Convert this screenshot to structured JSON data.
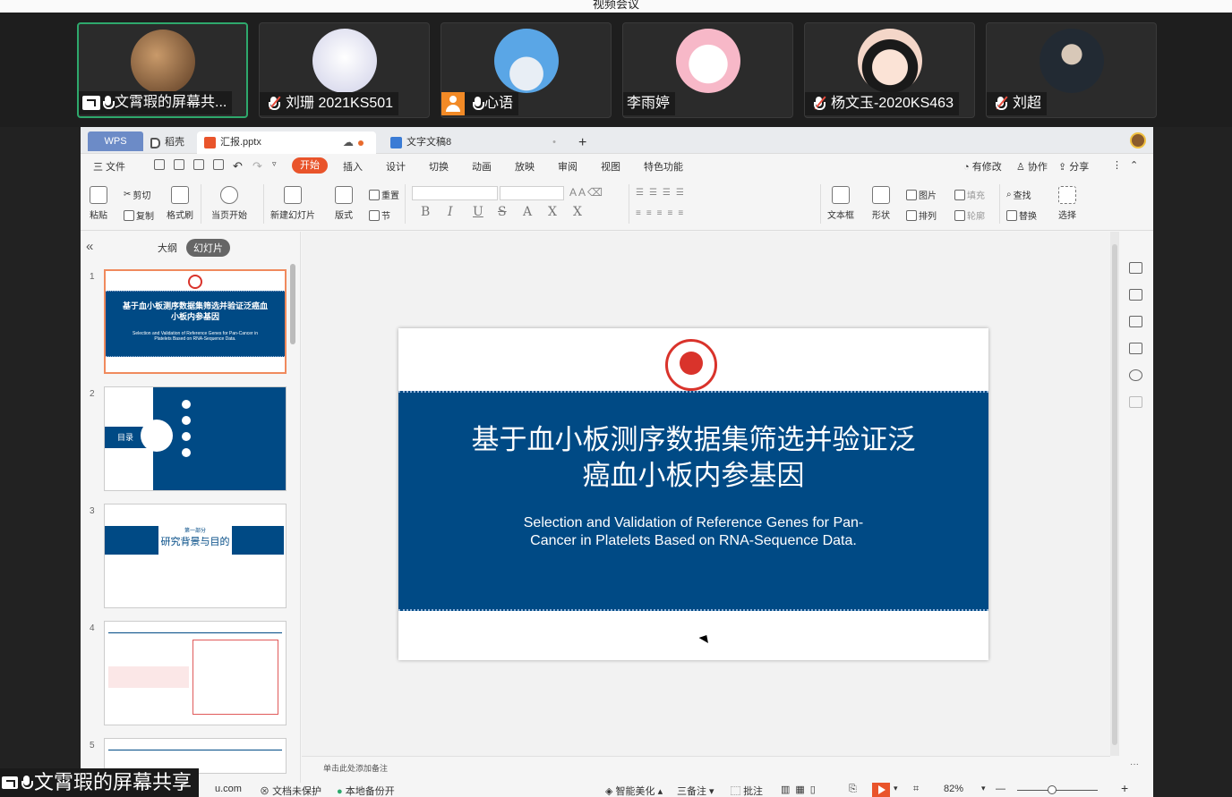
{
  "meeting": {
    "title": "视频会议",
    "participants": [
      {
        "name": "文霄瑕的屏幕共...",
        "sharing": true,
        "muted": false,
        "avatar_color": "#7a5a3a"
      },
      {
        "name": "刘珊 2021KS501",
        "sharing": false,
        "muted": true,
        "avatar_color": "#c9c9e6"
      },
      {
        "name": "心语",
        "sharing": false,
        "muted": false,
        "person_icon": true,
        "avatar_color": "#5aa6e6"
      },
      {
        "name": "李雨婷",
        "sharing": false,
        "muted": false,
        "avatar_color": "#f7b8c8"
      },
      {
        "name": "杨文玉-2020KS463",
        "sharing": false,
        "muted": true,
        "avatar_color": "#f4d6c8"
      },
      {
        "name": "刘超",
        "sharing": false,
        "muted": true,
        "avatar_color": "#222a33"
      }
    ],
    "share_label": "文霄瑕的屏幕共享"
  },
  "wps": {
    "tabs": {
      "wps": "WPS",
      "docer": "稻壳",
      "file1": "汇报.pptx",
      "file2": "文字文稿8",
      "new_tab": "+"
    },
    "menu": {
      "file": "三 文件",
      "start": "开始",
      "items": [
        "插入",
        "设计",
        "切换",
        "动画",
        "放映",
        "审阅",
        "视图",
        "特色功能"
      ],
      "right": [
        "有修改",
        "协作",
        "分享"
      ]
    },
    "ribbon": {
      "paste": "粘贴",
      "cut": "剪切",
      "copy": "复制",
      "format_painter": "格式刷",
      "from_current": "当页开始",
      "new_slide": "新建幻灯片",
      "layout": "版式",
      "section": "节",
      "reset": "重置",
      "textbox": "文本框",
      "shape": "形状",
      "picture": "图片",
      "arrange": "排列",
      "fill": "填充",
      "outline": "轮廓",
      "find": "查找",
      "replace": "替换",
      "select": "选择"
    },
    "panel": {
      "outline_tab": "大纲",
      "slides_tab": "幻灯片",
      "slide_numbers": [
        "1",
        "2",
        "3",
        "4",
        "5"
      ],
      "thumb1_title": "基于血小板测序数据集筛选并验证泛癌血小板内参基因",
      "thumb1_sub": "Selection and Validation of Reference Genes for Pan-Cancer in Platelets Based on RNA-Sequence Data.",
      "thumb2_label": "目录",
      "thumb3_part": "第一部分",
      "thumb3_title": "研究背景与目的"
    },
    "slide": {
      "cn_title_line1": "基于血小板测序数据集筛选并验证泛",
      "cn_title_line2": "癌血小板内参基因",
      "en_title_line1": "Selection and Validation of Reference Genes for Pan-",
      "en_title_line2": "Cancer in Platelets Based on RNA-Sequence Data."
    },
    "notes_placeholder": "单击此处添加备注",
    "status": {
      "left": "u.com",
      "protect": "文档未保护",
      "backup": "本地备份开",
      "beautify": "智能美化",
      "notes": "三备注",
      "comment": "批注",
      "zoom": "82%",
      "minus": "—",
      "plus": "+"
    }
  },
  "colors": {
    "accent": "#e9542b",
    "slide_blue": "#004a85",
    "active_tile": "#2ea86c"
  }
}
